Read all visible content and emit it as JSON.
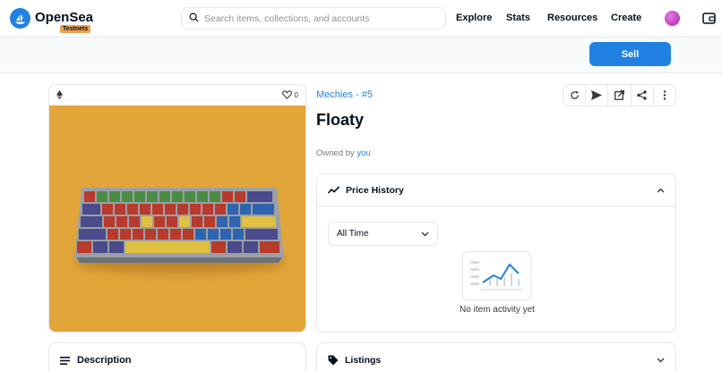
{
  "header": {
    "brand": "OpenSea",
    "badge": "Testnets",
    "search_placeholder": "Search items, collections, and accounts",
    "nav": [
      "Explore",
      "Stats",
      "Resources",
      "Create"
    ]
  },
  "sellbar": {
    "sell_label": "Sell"
  },
  "asset": {
    "favorites": "0",
    "collection": "Mechies - #5",
    "title": "Floaty",
    "owned_by_prefix": "Owned by",
    "owner": "you"
  },
  "price_history": {
    "title": "Price History",
    "range": "All Time",
    "empty": "No item activity yet"
  },
  "panels": {
    "description": "Description",
    "listings": "Listings"
  },
  "colors": {
    "accent": "#2081e2",
    "artwork_bg": "#e2a53a",
    "badge": "#f0a04b"
  }
}
